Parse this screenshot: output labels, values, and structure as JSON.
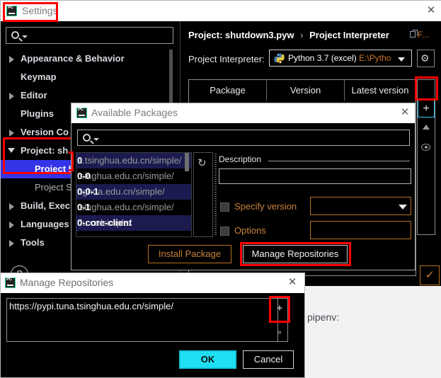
{
  "background": {
    "text": "pipenv:"
  },
  "settings_window": {
    "title": "Settings",
    "icon": "pycharm-icon",
    "close_icon": "close-icon",
    "search": {
      "placeholder": "",
      "value": "",
      "icon": "search-icon"
    },
    "help_icon": "help-icon",
    "help_label": "?",
    "tree": [
      {
        "label": "Appearance & Behavior",
        "state": "collapsed",
        "selected": false
      },
      {
        "label": "Keymap",
        "state": "leaf",
        "selected": false
      },
      {
        "label": "Editor",
        "state": "collapsed",
        "selected": false
      },
      {
        "label": "Plugins",
        "state": "leaf",
        "selected": false
      },
      {
        "label": "Version Co",
        "state": "collapsed",
        "selected": false
      },
      {
        "label": "Project: sh",
        "state": "expanded",
        "selected": false
      },
      {
        "label": "Project I",
        "state": "child",
        "selected": true
      },
      {
        "label": "Project S",
        "state": "child-dim",
        "selected": false
      },
      {
        "label": "Build, Exec",
        "state": "collapsed",
        "selected": false
      },
      {
        "label": "Languages",
        "state": "collapsed",
        "selected": false
      },
      {
        "label": "Tools",
        "state": "collapsed",
        "selected": false
      }
    ]
  },
  "right_pane": {
    "breadcrumb": {
      "project": "Project: shutdown3.pyw",
      "separator": "›",
      "page": "Project Interpreter"
    },
    "breadcrumb_right_text": "F...",
    "interpreter_label": "Project Interpreter:",
    "interpreter_value": "Python 3.7 (excel)",
    "interpreter_path": "E:\\Pytho",
    "gear_icon": "gear-icon",
    "table_headers": [
      "Package",
      "Version",
      "Latest version"
    ],
    "toolbar": [
      {
        "icon": "plus-icon",
        "label": "+",
        "highlighted": true
      },
      {
        "icon": "minus-icon",
        "label": "−",
        "highlighted": false
      },
      {
        "icon": "arrow-up-icon",
        "label": "",
        "highlighted": false
      },
      {
        "icon": "eye-icon",
        "label": "",
        "highlighted": false
      }
    ]
  },
  "available_packages_dialog": {
    "title": "Available Packages",
    "icon": "pycharm-icon",
    "close_icon": "close-icon",
    "search": {
      "placeholder": "",
      "value": "",
      "icon": "search-icon"
    },
    "refresh_icon": "refresh-icon",
    "packages": [
      {
        "name": "0",
        "url": "a.tsinghua.edu.cn/simple/",
        "highlighted": true
      },
      {
        "name": "0-0",
        "url": "tsinghua.edu.cn/simple/",
        "highlighted": false
      },
      {
        "name": "0-0-1",
        "url": "nghua.edu.cn/simple/",
        "highlighted": true
      },
      {
        "name": "0-1",
        "url": "tsinghua.edu.cn/simple/",
        "highlighted": false
      },
      {
        "name": "0-core-client",
        "url": "du.cn/simple/",
        "highlighted": true
      }
    ],
    "description_label": "Description",
    "description_value": "",
    "specify_version_label": "Specify version",
    "specify_version_checked": false,
    "specify_version_value": "",
    "options_label": "Options",
    "options_checked": false,
    "options_value": "",
    "install_button": "Install Package",
    "manage_button": "Manage Repositories"
  },
  "manage_repositories_dialog": {
    "title": "Manage Repositories",
    "icon": "pycharm-icon",
    "close_icon": "close-icon",
    "repositories": [
      "https://pypi.tuna.tsinghua.edu.cn/simple/"
    ],
    "add_button": "+",
    "expand_button": "»",
    "ok_button": "OK",
    "cancel_button": "Cancel"
  },
  "colors": {
    "highlight_red": "#fe0000",
    "accent_cyan": "#1fe0f2",
    "accent_orange": "#c8823c",
    "selection_blue": "#3333e8",
    "row_blue": "#1b1b50"
  }
}
